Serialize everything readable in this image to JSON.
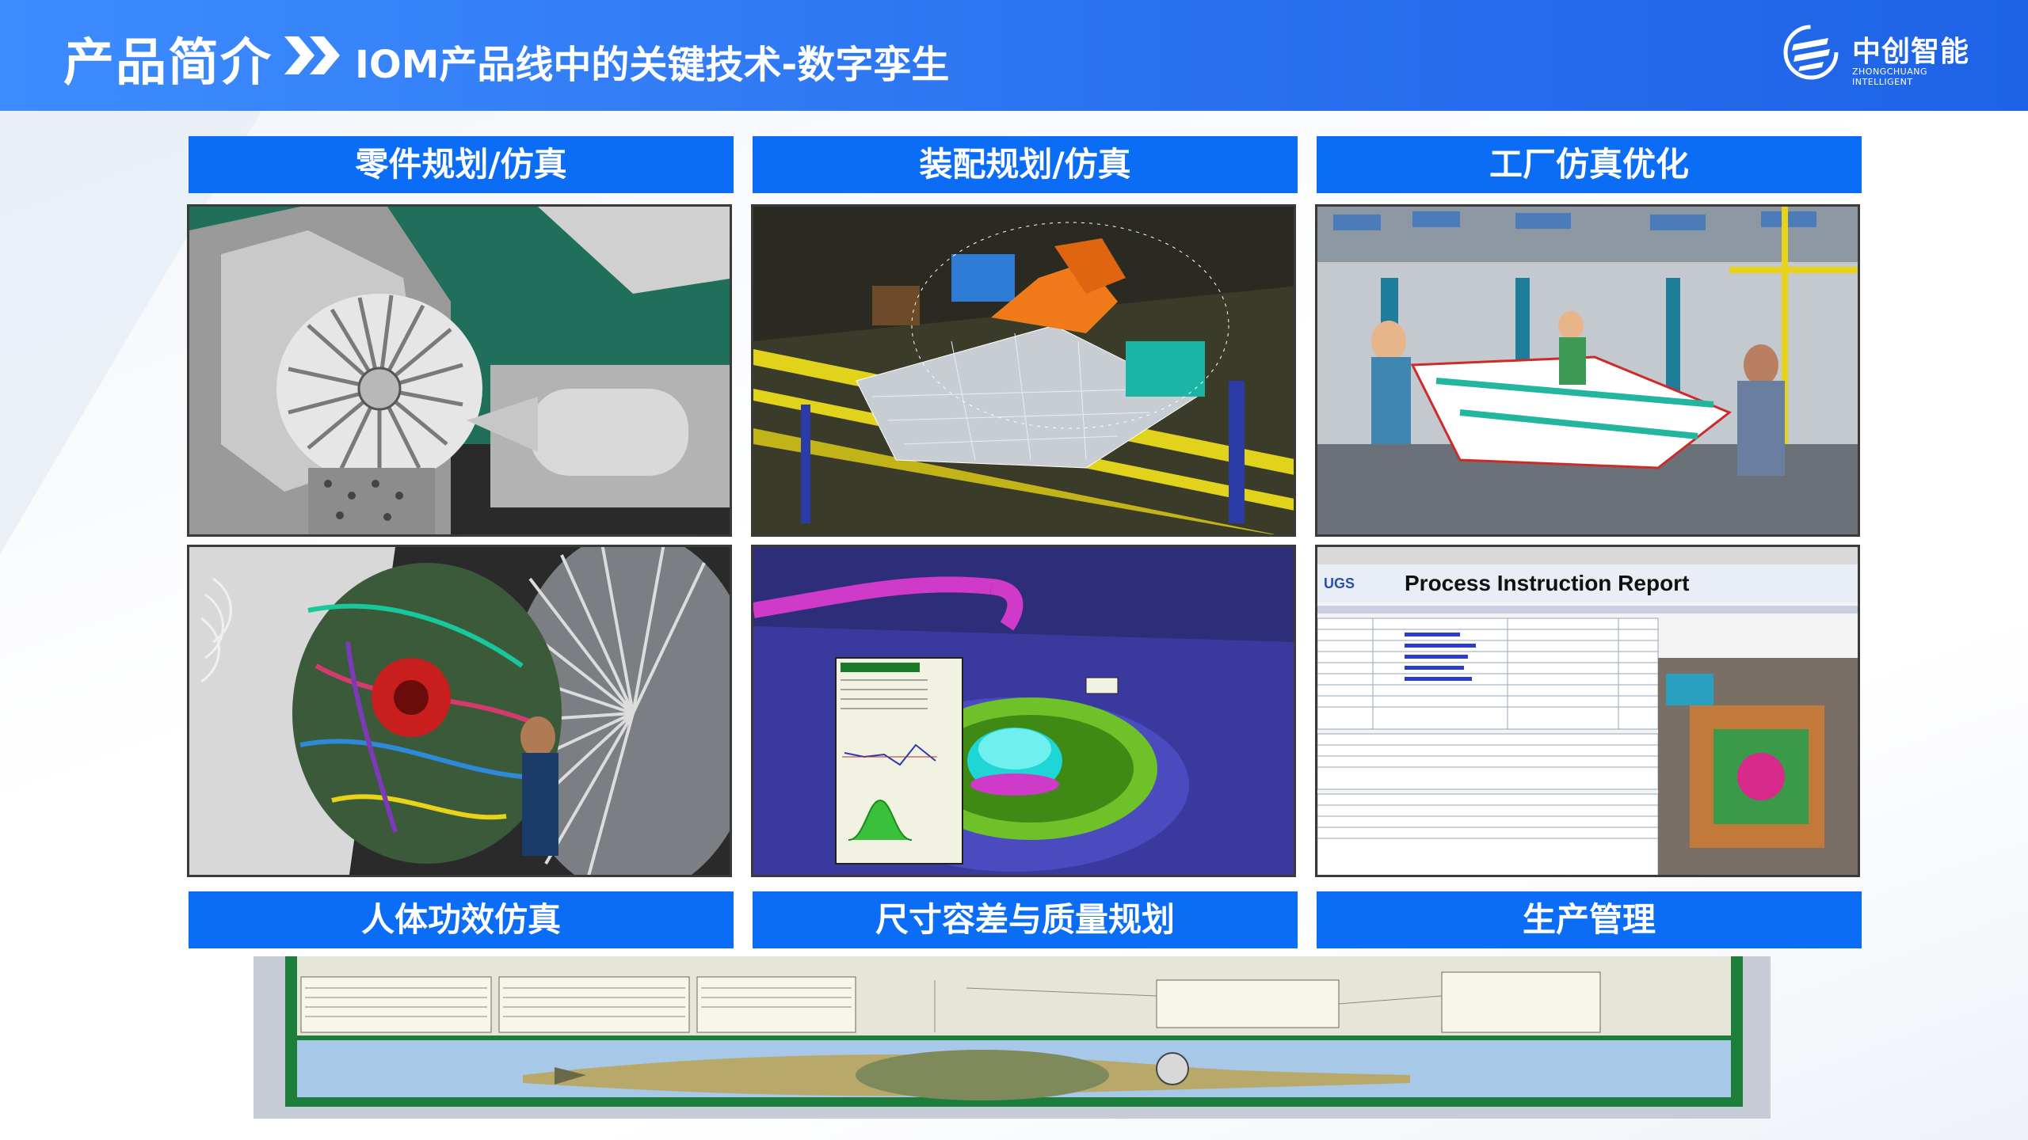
{
  "header": {
    "title": "产品简介",
    "subtitle": "IOM产品线中的关键技术-数字孪生",
    "brand_cn": "中创智能",
    "brand_en": "ZHONGCHUANG INTELLIGENT"
  },
  "panels": {
    "top_labels": [
      "零件规划/仿真",
      "装配规划/仿真",
      "工厂仿真优化"
    ],
    "bottom_labels": [
      "人体功效仿真",
      "尺寸容差与质量规划",
      "生产管理"
    ],
    "report_title": "Process Instruction Report",
    "report_logo": "UGS"
  },
  "colors": {
    "header_blue": "#2b72f0",
    "label_blue": "#0b6cf5"
  }
}
